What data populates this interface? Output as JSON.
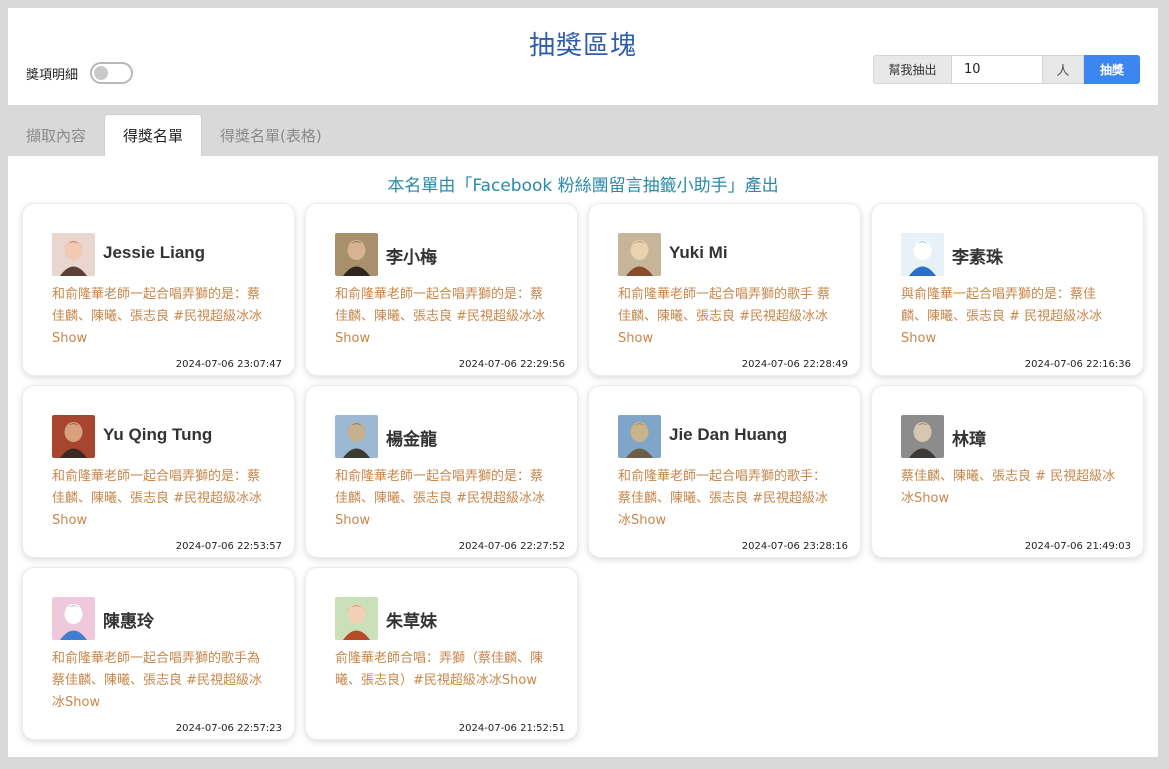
{
  "header": {
    "title": "抽獎區塊",
    "toggle_label": "獎項明細",
    "draw_prefix": "幫我抽出",
    "draw_count": "10",
    "draw_unit": "人",
    "draw_button": "抽獎"
  },
  "tabs": [
    {
      "label": "擷取內容"
    },
    {
      "label": "得獎名單"
    },
    {
      "label": "得獎名單(表格)"
    }
  ],
  "banner": "本名單由「Facebook 粉絲團留言抽籤小助手」產出",
  "colors": {
    "title": "#2f5dab",
    "accent_button": "#3b86f0",
    "banner": "#2a8aa8",
    "message": "#c8874b"
  },
  "winners": [
    {
      "name": "Jessie Liang",
      "message": "和俞隆華老師一起合唱弄獅的是：蔡佳麟、陳曦、張志良 #民視超級冰冰Show",
      "time": "2024-07-06 23:07:47",
      "avatar": "avatar-icon"
    },
    {
      "name": "李小梅",
      "message": "和俞隆華老師一起合唱弄獅的是：蔡佳麟、陳曦、張志良 #民視超級冰冰Show",
      "time": "2024-07-06 22:29:56",
      "avatar": "avatar-icon"
    },
    {
      "name": "Yuki Mi",
      "message": "和俞隆華老師一起合唱弄獅的歌手 蔡佳麟、陳曦、張志良 #民視超級冰冰Show",
      "time": "2024-07-06 22:28:49",
      "avatar": "avatar-icon"
    },
    {
      "name": "李素珠",
      "message": "與俞隆華一起合唱弄獅的是：蔡佳麟、陳曦、張志良 # 民視超級冰冰Show",
      "time": "2024-07-06 22:16:36",
      "avatar": "avatar-icon"
    },
    {
      "name": "Yu Qing Tung",
      "message": "和俞隆華老師一起合唱弄獅的是：蔡佳麟、陳曦、張志良 #民視超級冰冰Show",
      "time": "2024-07-06 22:53:57",
      "avatar": "avatar-icon"
    },
    {
      "name": "楊金龍",
      "message": "和俞隆華老師一起合唱弄獅的是：蔡佳麟、陳曦、張志良 #民視超級冰冰Show",
      "time": "2024-07-06 22:27:52",
      "avatar": "avatar-icon"
    },
    {
      "name": "Jie Dan Huang",
      "message": "和俞隆華老師一起合唱弄獅的歌手：蔡佳麟、陳曦、張志良 #民視超級冰冰Show",
      "time": "2024-07-06 23:28:16",
      "avatar": "avatar-icon"
    },
    {
      "name": "林璋",
      "message": "蔡佳麟、陳曦、張志良 # 民視超級冰冰Show",
      "time": "2024-07-06 21:49:03",
      "avatar": "avatar-icon"
    },
    {
      "name": "陳惠玲",
      "message": "和俞隆華老師一起合唱弄獅的歌手為 蔡佳麟、陳曦、張志良 #民視超級冰冰Show",
      "time": "2024-07-06 22:57:23",
      "avatar": "avatar-icon"
    },
    {
      "name": "朱草妹",
      "message": "俞隆華老師合唱：弄獅（蔡佳麟、陳曦、張志良）#民視超級冰冰Show",
      "time": "2024-07-06 21:52:51",
      "avatar": "avatar-icon"
    }
  ]
}
